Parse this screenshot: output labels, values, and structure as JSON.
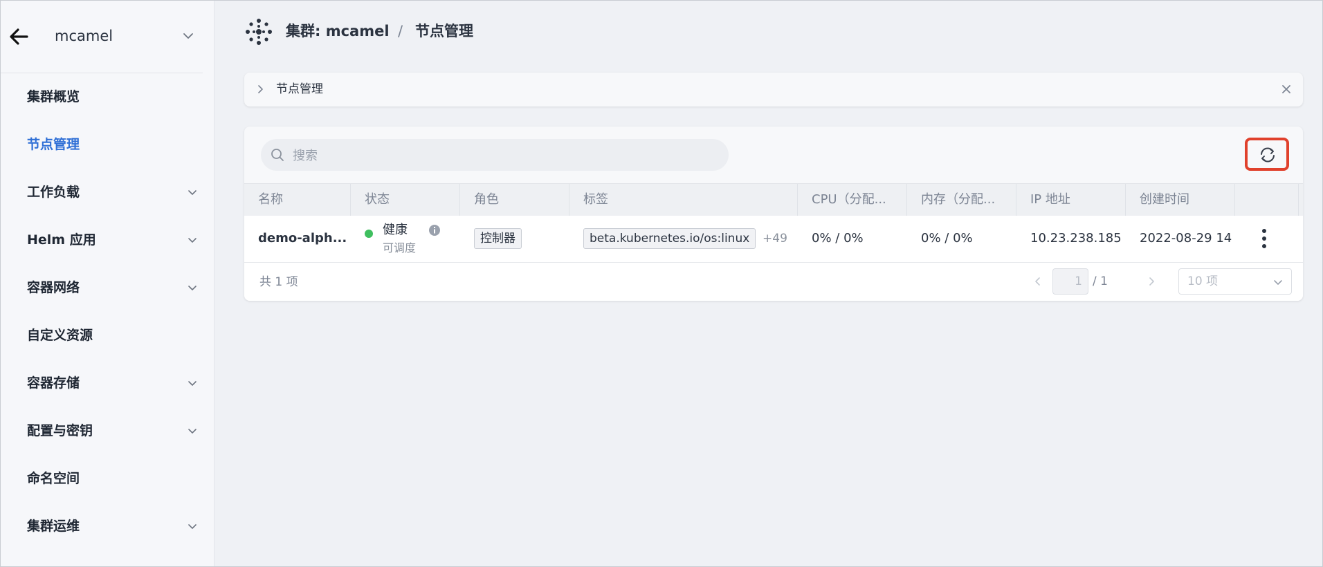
{
  "sidebar": {
    "cluster_name": "mcamel",
    "items": [
      {
        "label": "集群概览",
        "active": false,
        "has_children": false
      },
      {
        "label": "节点管理",
        "active": true,
        "has_children": false
      },
      {
        "label": "工作负载",
        "active": false,
        "has_children": true
      },
      {
        "label": "Helm 应用",
        "active": false,
        "has_children": true
      },
      {
        "label": "容器网络",
        "active": false,
        "has_children": true
      },
      {
        "label": "自定义资源",
        "active": false,
        "has_children": false
      },
      {
        "label": "容器存储",
        "active": false,
        "has_children": true
      },
      {
        "label": "配置与密钥",
        "active": false,
        "has_children": true
      },
      {
        "label": "命名空间",
        "active": false,
        "has_children": false
      },
      {
        "label": "集群运维",
        "active": false,
        "has_children": true
      }
    ]
  },
  "header": {
    "crumb_cluster": "集群: mcamel",
    "separator": "/",
    "crumb_page": "节点管理"
  },
  "breadcrumb_panel": {
    "title": "节点管理"
  },
  "toolbar": {
    "search_placeholder": "搜索"
  },
  "table": {
    "columns": [
      "名称",
      "状态",
      "角色",
      "标签",
      "CPU（分配...",
      "内存（分配...",
      "IP 地址",
      "创建时间",
      ""
    ],
    "rows": [
      {
        "name": "demo-alph...",
        "status": "健康",
        "status_sub": "可调度",
        "role": "控制器",
        "label": "beta.kubernetes.io/os:linux",
        "label_more": "+49",
        "cpu": "0% / 0%",
        "memory": "0% / 0%",
        "ip": "10.23.238.185",
        "created": "2022-08-29 14"
      }
    ]
  },
  "footer": {
    "total": "共 1 项",
    "page_current": "1",
    "page_total": "/ 1",
    "per_page": "10 项"
  },
  "colors": {
    "accent": "#2f6fd6",
    "healthy": "#3fbf5f",
    "highlight": "#e0412c"
  },
  "icons": [
    "back-arrow-icon",
    "chevron-down-icon",
    "cluster-logo-icon",
    "chevron-right-icon",
    "close-icon",
    "search-icon",
    "refresh-icon",
    "info-icon",
    "more-vertical-icon",
    "chevron-left-icon"
  ]
}
